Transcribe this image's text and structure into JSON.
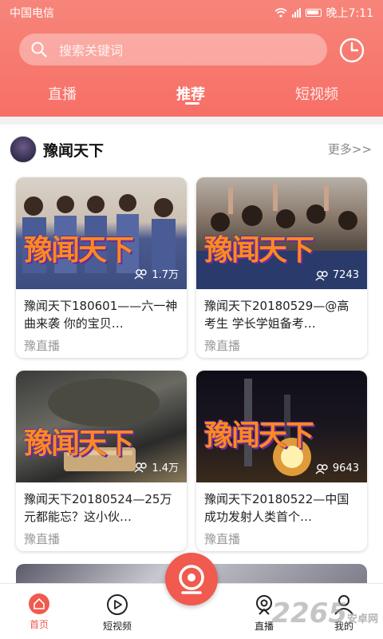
{
  "status": {
    "carrier": "中国电信",
    "time": "晚上7:11"
  },
  "search": {
    "placeholder": "搜索关键词"
  },
  "tabs": [
    {
      "label": "直播"
    },
    {
      "label": "推荐",
      "active": true
    },
    {
      "label": "短视频"
    }
  ],
  "section": {
    "title": "豫闻天下",
    "more": "更多>>"
  },
  "cards": [
    {
      "overlay": "豫闻天下",
      "views": "1.7万",
      "title": "豫闻天下180601——六一神曲来袭 你的宝贝…",
      "source": "豫直播"
    },
    {
      "overlay": "豫闻天下",
      "views": "7243",
      "title": "豫闻天下20180529—@高考生 学长学姐备考…",
      "source": "豫直播"
    },
    {
      "overlay": "豫闻天下",
      "views": "1.4万",
      "title": "豫闻天下20180524—25万元都能忘？这小伙…",
      "source": "豫直播"
    },
    {
      "overlay": "豫闻天下",
      "views": "9643",
      "title": "豫闻天下20180522—中国成功发射人类首个…",
      "source": "豫直播"
    }
  ],
  "nav": [
    {
      "label": "首页",
      "icon": "home-icon",
      "active": true
    },
    {
      "label": "短视频",
      "icon": "play-circle-icon"
    },
    {
      "label": "直播",
      "icon": "live-camera-icon"
    },
    {
      "label": "我的",
      "icon": "profile-icon"
    }
  ],
  "watermark": {
    "text": "2265",
    "suffix": "安卓网"
  },
  "colors": {
    "accent": "#f05a4f",
    "header_top": "#f7857a",
    "header_bottom": "#f76f66"
  }
}
